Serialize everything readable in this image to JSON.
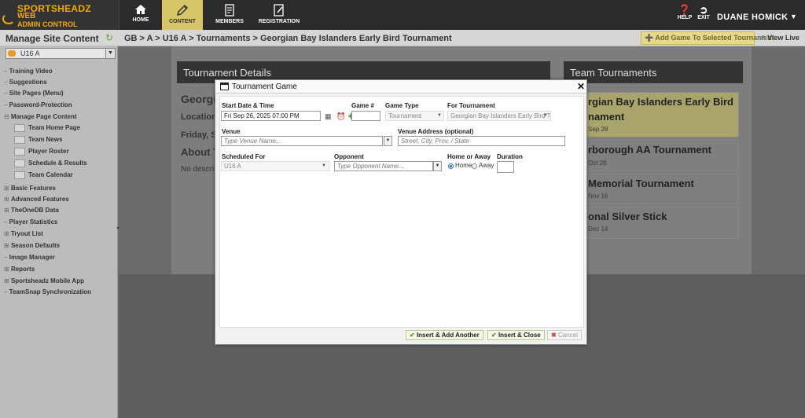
{
  "app": {
    "logo_line1": "SPORTSHEADZ",
    "logo_line2": "WEB",
    "logo_line3": "ADMIN CONTROL",
    "nav": [
      {
        "label": "HOME",
        "icon": "home-icon"
      },
      {
        "label": "CONTENT",
        "icon": "pencil-icon"
      },
      {
        "label": "MEMBERS",
        "icon": "members-icon"
      },
      {
        "label": "REGISTRATION",
        "icon": "registration-icon"
      }
    ],
    "help_label": "HELP",
    "exit_label": "EXIT",
    "username": "DUANE HOMICK",
    "accent_color": "#d7c56a"
  },
  "subbar": {
    "title": "Manage Site Content",
    "breadcrumb": "GB > A > U16 A > Tournaments > Georgian Bay Islanders Early Bird Tournament",
    "add_game_button": "Add Game To Selected Tournament",
    "view_live": "View Live"
  },
  "sidebar": {
    "team_select": "U16 A",
    "items": [
      "Training Video",
      "Suggestions",
      "Site Pages (Menu)",
      "Password-Protection",
      "Manage Page Content"
    ],
    "sub_items": [
      "Team Home Page",
      "Team News",
      "Player Roster",
      "Schedule & Results",
      "Team Calendar"
    ],
    "items2": [
      "Basic Features",
      "Advanced Features",
      "TheOneDB Data",
      "Player Statistics",
      "Tryout List",
      "Season Defaults",
      "Image Manager",
      "Reports",
      "Sportsheadz Mobile App",
      "TeamSnap Synchronization"
    ]
  },
  "background": {
    "details_header": "Tournament Details",
    "details_title": "Georgi",
    "details_location": "Location",
    "details_date": "Friday, S",
    "details_about": "About T",
    "details_desc": "No descri",
    "teams_header": "Team Tournaments",
    "tournaments": [
      {
        "name1": "rgian Bay Islanders Early Bird",
        "name2": "nament",
        "date": "Sep 28"
      },
      {
        "name1": "rborough AA Tournament",
        "date": "Oct 26"
      },
      {
        "name1": "Memorial Tournament",
        "date": "Nov 16"
      },
      {
        "name1": "onal Silver Stick",
        "date": "Dec 14"
      }
    ]
  },
  "modal": {
    "title": "Tournament Game",
    "labels": {
      "start": "Start Date & Time",
      "game_no": "Game #",
      "game_type": "Game Type",
      "for_tournament": "For Tournament",
      "venue": "Venue",
      "venue_address": "Venue Address (optional)",
      "scheduled_for": "Scheduled For",
      "opponent": "Opponent",
      "home_away": "Home or Away",
      "duration": "Duration",
      "home": "Home",
      "away": "Away"
    },
    "values": {
      "start": "Fri Sep 26, 2025 07:00 PM",
      "game_no": "",
      "game_type": "Tournament",
      "for_tournament": "Georgian Bay Islanders Early Bird T",
      "scheduled_for": "U16 A",
      "duration": ""
    },
    "placeholders": {
      "venue": "Type Venue Name...",
      "venue_address": "Street, City, Prov. / State",
      "opponent": "Type Opponent Name..."
    },
    "buttons": {
      "insert_add": "Insert & Add Another",
      "insert_close": "Insert & Close",
      "cancel": "Cancel"
    }
  }
}
